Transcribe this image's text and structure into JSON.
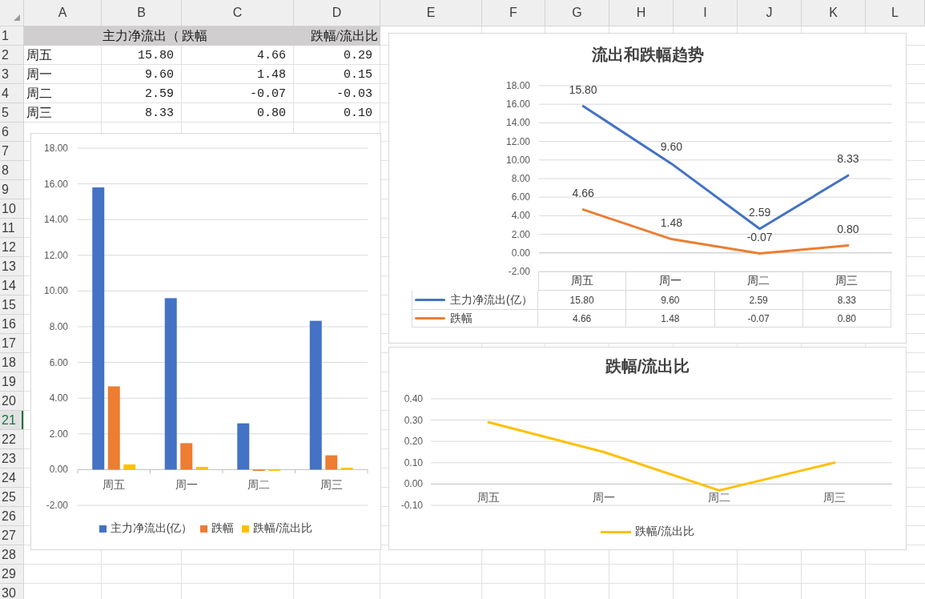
{
  "sheet": {
    "columns": [
      "A",
      "B",
      "C",
      "D",
      "E",
      "F",
      "G",
      "H",
      "I",
      "J",
      "K",
      "L"
    ],
    "rows": [
      {
        "label": "1",
        "selected": false
      },
      {
        "label": "2",
        "selected": false
      },
      {
        "label": "3",
        "selected": false
      },
      {
        "label": "4",
        "selected": false
      },
      {
        "label": "5",
        "selected": false
      },
      {
        "label": "6",
        "selected": false
      },
      {
        "label": "7",
        "selected": false
      },
      {
        "label": "8",
        "selected": false
      },
      {
        "label": "9",
        "selected": false
      },
      {
        "label": "10",
        "selected": false
      },
      {
        "label": "11",
        "selected": false
      },
      {
        "label": "12",
        "selected": false
      },
      {
        "label": "13",
        "selected": false
      },
      {
        "label": "14",
        "selected": false
      },
      {
        "label": "15",
        "selected": false
      },
      {
        "label": "16",
        "selected": false
      },
      {
        "label": "17",
        "selected": false
      },
      {
        "label": "18",
        "selected": false
      },
      {
        "label": "19",
        "selected": false
      },
      {
        "label": "20",
        "selected": false
      },
      {
        "label": "21",
        "selected": true
      },
      {
        "label": "22",
        "selected": false
      },
      {
        "label": "23",
        "selected": false
      },
      {
        "label": "24",
        "selected": false
      },
      {
        "label": "25",
        "selected": false
      },
      {
        "label": "26",
        "selected": false
      },
      {
        "label": "27",
        "selected": false
      },
      {
        "label": "28",
        "selected": false
      },
      {
        "label": "29",
        "selected": false
      },
      {
        "label": "30",
        "selected": false
      }
    ],
    "header_cells": [
      "主力净流出（",
      "跌幅",
      "跌幅/流出比"
    ],
    "data_rows": [
      {
        "cells": [
          "周五",
          "15.80",
          "4.66",
          "0.29"
        ]
      },
      {
        "cells": [
          "周一",
          "9.60",
          "1.48",
          "0.15"
        ]
      },
      {
        "cells": [
          "周二",
          "2.59",
          "-0.07",
          "-0.03"
        ]
      },
      {
        "cells": [
          "周三",
          "8.33",
          "0.80",
          "0.10"
        ]
      }
    ]
  },
  "charts": [
    {
      "chart_data": {
        "type": "bar",
        "categories": [
          "周五",
          "周一",
          "周二",
          "周三"
        ],
        "series": [
          {
            "name": "主力净流出(亿）",
            "color": "#4472c4",
            "values": [
              15.8,
              9.6,
              2.59,
              8.33
            ]
          },
          {
            "name": "跌幅",
            "color": "#ed7d31",
            "values": [
              4.66,
              1.48,
              -0.07,
              0.8
            ]
          },
          {
            "name": "跌幅/流出比",
            "color": "#ffc000",
            "values": [
              0.29,
              0.15,
              -0.03,
              0.1
            ]
          }
        ],
        "ylim": [
          -2,
          18
        ],
        "yticks": [
          {
            "value": -2,
            "label": "-2.00"
          },
          {
            "value": 0,
            "label": "0.00"
          },
          {
            "value": 2,
            "label": "2.00"
          },
          {
            "value": 4,
            "label": "4.00"
          },
          {
            "value": 6,
            "label": "6.00"
          },
          {
            "value": 8,
            "label": "8.00"
          },
          {
            "value": 10,
            "label": "10.00"
          },
          {
            "value": 12,
            "label": "12.00"
          },
          {
            "value": 14,
            "label": "14.00"
          },
          {
            "value": 16,
            "label": "16.00"
          },
          {
            "value": 18,
            "label": "18.00"
          }
        ],
        "grid": true,
        "legend": "bottom"
      }
    },
    {
      "chart_data": {
        "type": "line",
        "title": "流出和跌幅趋势",
        "categories": [
          "周五",
          "周一",
          "周二",
          "周三"
        ],
        "series": [
          {
            "name": "主力净流出(亿）",
            "color": "#4472c4",
            "values": [
              15.8,
              9.6,
              2.59,
              8.33
            ]
          },
          {
            "name": "跌幅",
            "color": "#ed7d31",
            "values": [
              4.66,
              1.48,
              -0.07,
              0.8
            ]
          }
        ],
        "ylim": [
          -2,
          18
        ],
        "yticks": [
          {
            "value": -2,
            "label": "-2.00"
          },
          {
            "value": 0,
            "label": "0.00"
          },
          {
            "value": 2,
            "label": "2.00"
          },
          {
            "value": 4,
            "label": "4.00"
          },
          {
            "value": 6,
            "label": "6.00"
          },
          {
            "value": 8,
            "label": "8.00"
          },
          {
            "value": 10,
            "label": "10.00"
          },
          {
            "value": 12,
            "label": "12.00"
          },
          {
            "value": 14,
            "label": "14.00"
          },
          {
            "value": 16,
            "label": "16.00"
          },
          {
            "value": 18,
            "label": "18.00"
          }
        ],
        "grid": true,
        "legend": "bottom",
        "value_labels": [
          [
            "15.80",
            "9.60",
            "2.59",
            "8.33"
          ],
          [
            "4.66",
            "1.48",
            "-0.07",
            "0.80"
          ]
        ]
      },
      "data_table": {
        "rows": [
          {
            "cells": [
              "15.80",
              "9.60",
              "2.59",
              "8.33"
            ]
          },
          {
            "cells": [
              "4.66",
              "1.48",
              "-0.07",
              "0.80"
            ]
          }
        ]
      }
    },
    {
      "chart_data": {
        "type": "line",
        "title": "跌幅/流出比",
        "categories": [
          "周五",
          "周一",
          "周二",
          "周三"
        ],
        "series": [
          {
            "name": "跌幅/流出比",
            "color": "#ffc000",
            "values": [
              0.29,
              0.15,
              -0.03,
              0.1
            ]
          }
        ],
        "ylim": [
          -0.1,
          0.4
        ],
        "yticks": [
          {
            "value": -0.1,
            "label": "-0.10"
          },
          {
            "value": 0,
            "label": "0.00"
          },
          {
            "value": 0.1,
            "label": "0.10"
          },
          {
            "value": 0.2,
            "label": "0.20"
          },
          {
            "value": 0.3,
            "label": "0.30"
          },
          {
            "value": 0.4,
            "label": "0.40"
          }
        ],
        "grid": true,
        "legend": "bottom"
      }
    }
  ]
}
